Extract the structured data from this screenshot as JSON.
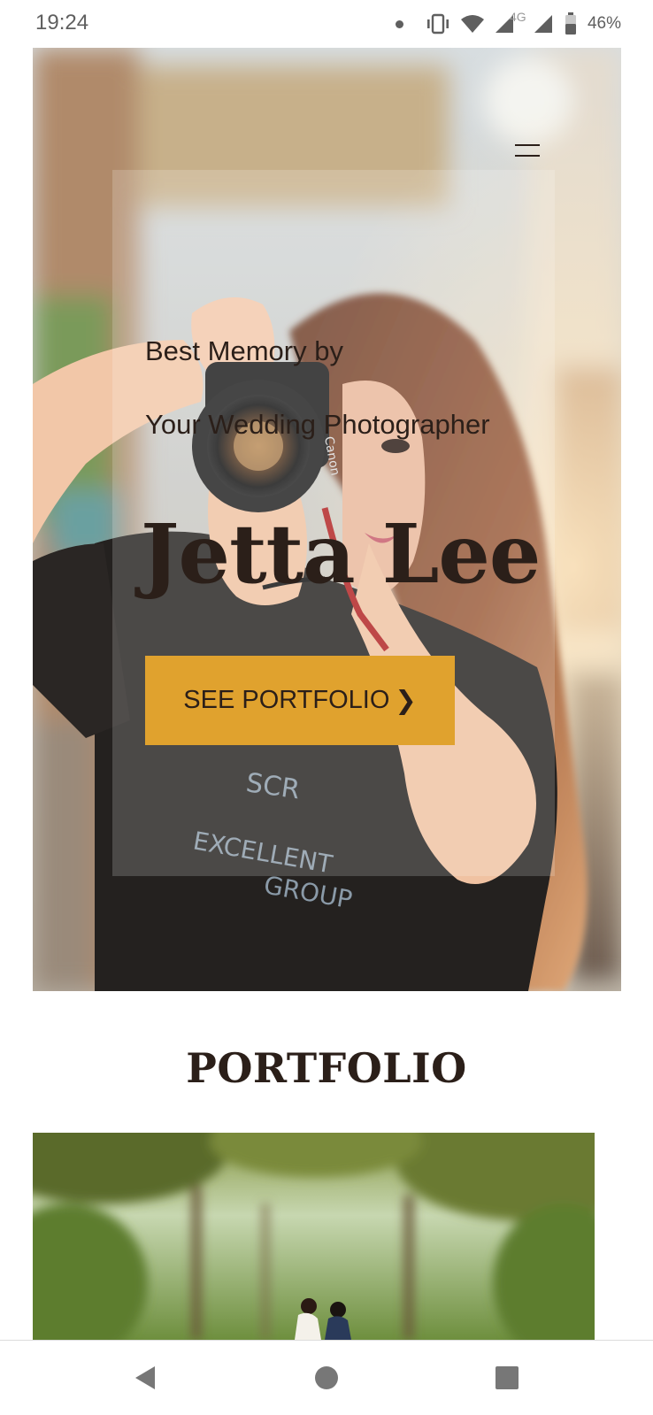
{
  "status_bar": {
    "time": "19:24",
    "network": "4G",
    "battery": "46%",
    "icons": [
      "notification-dot-icon",
      "vibrate-icon",
      "wifi-icon",
      "signal-icon",
      "signal-icon",
      "battery-icon"
    ]
  },
  "hero": {
    "menu_icon": "hamburger-menu-icon",
    "line1": "Best Memory by",
    "line2": "Your Wedding Photographer",
    "name": "Jetta Lee",
    "cta_label": "SEE PORTFOLIO",
    "cta_arrow": "❯",
    "colors": {
      "cta_background": "#e0a22e",
      "text": "#2b1f19"
    }
  },
  "portfolio": {
    "heading": "PORTFOLIO"
  },
  "nav_bar": {
    "icons": [
      "back-triangle-icon",
      "home-circle-icon",
      "recents-square-icon"
    ]
  }
}
